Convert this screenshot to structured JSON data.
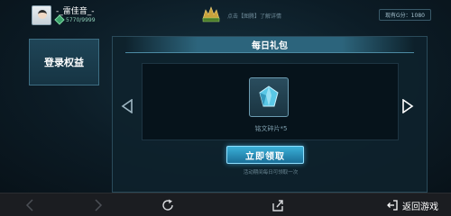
{
  "header": {
    "player_name": "-_雷佳音_-",
    "exp": "5770/9999",
    "tip": "点击【图腾】了解详情",
    "g_score": "现有G分：1080"
  },
  "sidebar": {
    "tab_label": "登录权益"
  },
  "panel": {
    "title": "每日礼包",
    "reward_label": "铭文碎片*5",
    "claim_label": "立即领取",
    "claim_note": "活动期间每日可领取一次"
  },
  "bottom_nav": {
    "return_label": "返回游戏"
  },
  "colors": {
    "accent": "#3ab0d8",
    "panel_header": "#2e6880",
    "background": "#0c1c26"
  },
  "icons": [
    "avatar",
    "level-icon",
    "game-logo-icon",
    "crystal-icon",
    "left-arrow-icon",
    "right-arrow-icon",
    "back-icon",
    "forward-icon",
    "refresh-icon",
    "share-icon",
    "return-icon"
  ]
}
